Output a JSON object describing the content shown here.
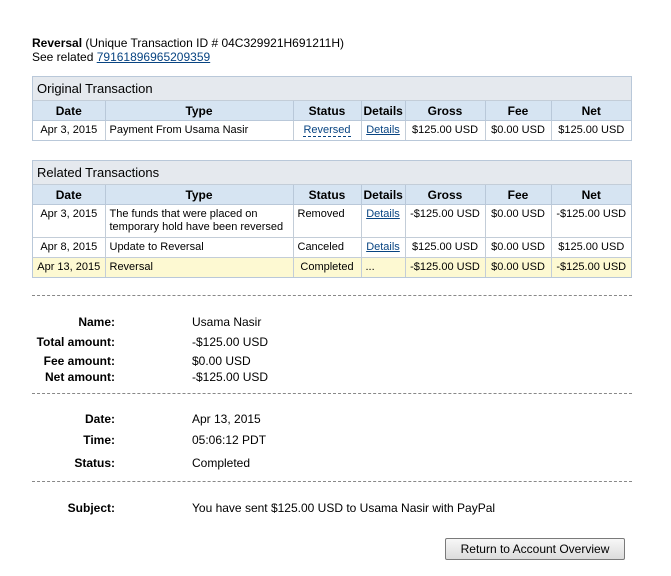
{
  "header": {
    "title_bold": "Reversal",
    "title_rest": " (Unique Transaction ID # 04C329921H691211H)",
    "see_related_label": "See related ",
    "see_related_id": "79161896965209359"
  },
  "original": {
    "section_title": "Original Transaction",
    "columns": [
      "Date",
      "Type",
      "Status",
      "Details",
      "Gross",
      "Fee",
      "Net"
    ],
    "rows": [
      {
        "date": "Apr 3, 2015",
        "type": "Payment From Usama Nasir",
        "status": "Reversed",
        "details": "Details",
        "gross": "$125.00 USD",
        "fee": "$0.00 USD",
        "net": "$125.00 USD"
      }
    ]
  },
  "related": {
    "section_title": "Related Transactions",
    "columns": [
      "Date",
      "Type",
      "Status",
      "Details",
      "Gross",
      "Fee",
      "Net"
    ],
    "rows": [
      {
        "date": "Apr 3, 2015",
        "type": "The funds that were placed on temporary hold have been reversed",
        "status": "Removed",
        "details": "Details",
        "gross": "-$125.00 USD",
        "fee": "$0.00 USD",
        "net": "-$125.00 USD"
      },
      {
        "date": "Apr 8, 2015",
        "type": "Update to Reversal",
        "status": "Canceled",
        "details": "Details",
        "gross": "$125.00 USD",
        "fee": "$0.00 USD",
        "net": "$125.00 USD"
      },
      {
        "date": "Apr 13, 2015",
        "type": "Reversal",
        "status": "Completed",
        "details": "...",
        "gross": "-$125.00 USD",
        "fee": "$0.00 USD",
        "net": "-$125.00 USD"
      }
    ]
  },
  "amounts": {
    "name_label": "Name:",
    "name_value": "Usama Nasir",
    "total_label": "Total amount:",
    "total_value": "-$125.00 USD",
    "fee_label": "Fee amount:",
    "fee_value": "$0.00 USD",
    "net_label": "Net amount:",
    "net_value": "-$125.00 USD"
  },
  "when": {
    "date_label": "Date:",
    "date_value": "Apr 13, 2015",
    "time_label": "Time:",
    "time_value": "05:06:12 PDT",
    "status_label": "Status:",
    "status_value": "Completed"
  },
  "subject": {
    "label": "Subject:",
    "value": "You have sent $125.00 USD to Usama Nasir with PayPal"
  },
  "return_button_label": "Return to Account Overview",
  "colors": {
    "header_bg": "#d6e4f2",
    "title_bg": "#e5e9ee",
    "highlight_row": "#fdf9d2",
    "link": "#084482"
  }
}
